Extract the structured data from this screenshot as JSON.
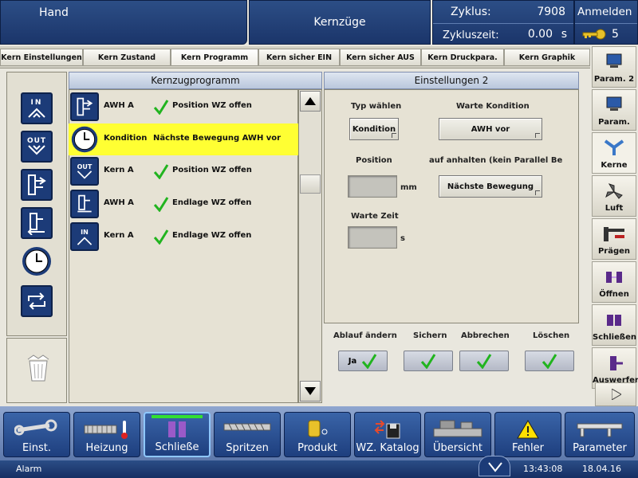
{
  "header": {
    "mode": "Hand",
    "title": "Kernzüge",
    "cycle_label": "Zyklus:",
    "cycle_value": "7908",
    "cycletime_label": "Zykluszeit:",
    "cycletime_value": "0.00",
    "cycletime_unit": "s",
    "login_label": "Anmelden",
    "user_level": "5"
  },
  "tabs": [
    "Kern Einstellungen",
    "Kern Zustand",
    "Kern Programm",
    "Kern sicher EIN",
    "Kern sicher AUS",
    "Kern Druckpara.",
    "Kern Graphik"
  ],
  "left_panel": {
    "title": "Kernzugprogramm",
    "rows": [
      {
        "a": "AWH A",
        "b": "Position WZ offen",
        "check": true,
        "selected": false
      },
      {
        "a": "Kondition",
        "b": "Nächste Bewegung  AWH vor",
        "check": false,
        "selected": true
      },
      {
        "a": "Kern A",
        "b": "Position WZ offen",
        "check": true,
        "selected": false
      },
      {
        "a": "AWH A",
        "b": "Endlage WZ offen",
        "check": true,
        "selected": false
      },
      {
        "a": "Kern A",
        "b": "Endlage WZ offen",
        "check": true,
        "selected": false
      }
    ]
  },
  "palette": {
    "in": "IN",
    "out": "OUT"
  },
  "settings": {
    "title": "Einstellungen 2",
    "typ_label": "Typ wählen",
    "typ_value": "Kondition",
    "warte_kondition_label": "Warte Kondition",
    "warte_kondition_value": "AWH vor",
    "position_label": "Position",
    "position_unit": "mm",
    "auf_anhalten_label": "auf anhalten (kein Parallel Be",
    "auf_anhalten_value": "Nächste Bewegung",
    "warte_zeit_label": "Warte Zeit",
    "warte_zeit_unit": "s"
  },
  "actions": {
    "ablauf_label": "Ablauf ändern",
    "ablauf_value": "Ja",
    "sichern_label": "Sichern",
    "abbrechen_label": "Abbrechen",
    "loeschen_label": "Löschen"
  },
  "sidebar": [
    "Param. 2",
    "Param.",
    "Kerne",
    "Luft",
    "Prägen",
    "Öffnen",
    "Schließen",
    "Auswerfer"
  ],
  "bottom_nav": [
    "Einst.",
    "Heizung",
    "Schließe",
    "Spritzen",
    "Produkt",
    "WZ. Katalog",
    "Übersicht",
    "Fehler",
    "Parameter"
  ],
  "status": {
    "alarm_label": "Alarm",
    "time": "13:43:08",
    "date": "18.04.16"
  },
  "colors": {
    "header_blue": "#1e3a72",
    "highlight_yellow": "#ffff33",
    "check_green": "#21b41f"
  }
}
